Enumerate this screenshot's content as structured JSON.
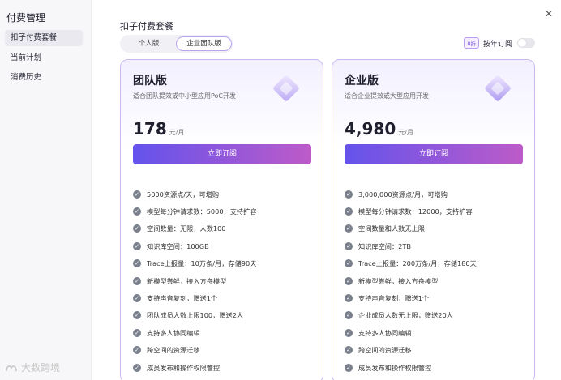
{
  "sidebar": {
    "title": "付费管理",
    "items": [
      {
        "label": "扣子付费套餐",
        "active": true
      },
      {
        "label": "当前计划",
        "active": false
      },
      {
        "label": "消费历史",
        "active": false
      }
    ]
  },
  "main": {
    "title": "扣子付费套餐",
    "close_icon": "close-icon",
    "tabs": [
      {
        "label": "个人版",
        "active": false
      },
      {
        "label": "企业团队版",
        "active": true
      }
    ],
    "annual": {
      "discount": "8折",
      "label": "按年订阅",
      "enabled": false
    }
  },
  "plans": [
    {
      "name": "团队版",
      "desc": "适合团队提效或中小型应用PoC开发",
      "price": "178",
      "unit": "元/月",
      "button": "立即订阅",
      "features": [
        "5000资源点/天，可增购",
        "模型每分钟请求数：5000，支持扩容",
        "空间数量：无限，人数100",
        "知识库空间：100GB",
        "Trace上报量：10万条/月，存储90天",
        "新模型尝鲜，接入方舟模型",
        "支持声音复刻，赠送1个",
        "团队成员人数上限100，赠送2人",
        "支持多人协同编辑",
        "跨空间的资源迁移",
        "成员发布和操作权限管控"
      ]
    },
    {
      "name": "企业版",
      "desc": "适合企业提效或大型应用开发",
      "price": "4,980",
      "unit": "元/月",
      "button": "立即订阅",
      "features": [
        "3,000,000资源点/月，可增购",
        "模型每分钟请求数：12000，支持扩容",
        "空间数量和人数无上限",
        "知识库空间：2TB",
        "Trace上报量：200万条/月，存储180天",
        "新模型尝鲜，接入方舟模型",
        "支持声音复刻，赠送1个",
        "企业成员人数无上限，赠送20人",
        "支持多人协同编辑",
        "跨空间的资源迁移",
        "成员发布和操作权限管控"
      ]
    }
  ],
  "watermark": "大数跨境",
  "colors": {
    "accent_start": "#6453ec",
    "accent_end": "#bd5bc8",
    "card_border": "#c8b8ee"
  }
}
